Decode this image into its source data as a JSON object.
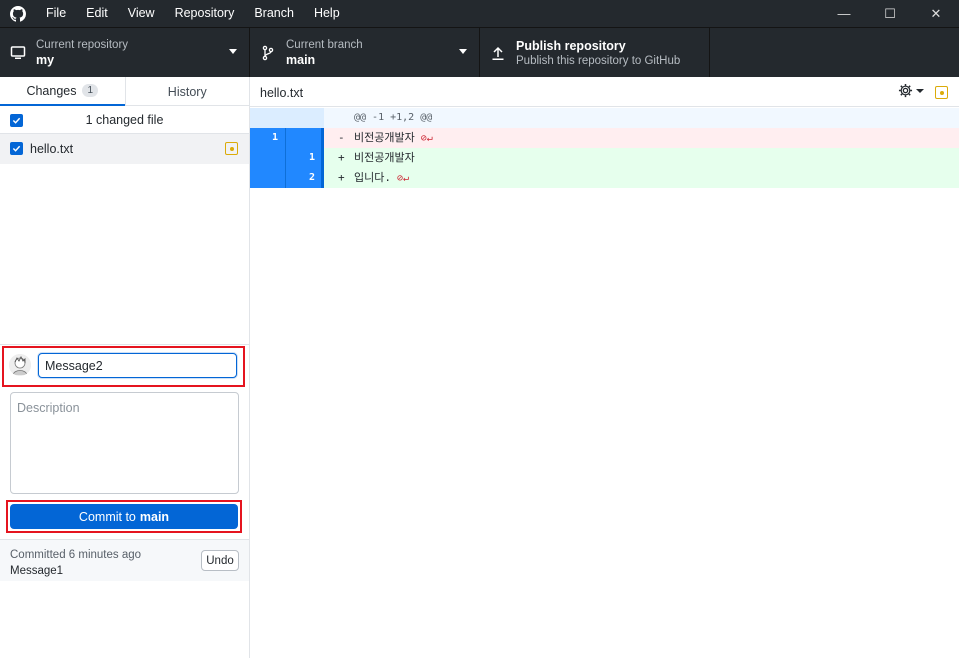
{
  "menu": [
    "File",
    "Edit",
    "View",
    "Repository",
    "Branch",
    "Help"
  ],
  "window_controls": {
    "minimize": "—",
    "maximize": "☐",
    "close": "✕"
  },
  "toolbar": {
    "repo_label": "Current repository",
    "repo_value": "my",
    "branch_label": "Current branch",
    "branch_value": "main",
    "publish_title": "Publish repository",
    "publish_sub": "Publish this repository to GitHub"
  },
  "tabs": {
    "changes": "Changes",
    "changes_count": "1",
    "history": "History"
  },
  "changes": {
    "header": "1 changed file",
    "files": [
      {
        "name": "hello.txt",
        "status": "modified"
      }
    ]
  },
  "commit": {
    "summary_value": "Message2",
    "description_placeholder": "Description",
    "button_prefix": "Commit to",
    "button_branch": "main"
  },
  "last_commit": {
    "text": "Committed 6 minutes ago",
    "message": "Message1",
    "undo": "Undo"
  },
  "diff": {
    "filename": "hello.txt",
    "hunk": "@@ -1 +1,2 @@",
    "lines": [
      {
        "type": "del",
        "old": "1",
        "new": "",
        "marker": "-",
        "text": "비전공개발자",
        "no_newline": true
      },
      {
        "type": "add",
        "old": "",
        "new": "1",
        "marker": "+",
        "text": "비전공개발자",
        "no_newline": false
      },
      {
        "type": "add",
        "old": "",
        "new": "2",
        "marker": "+",
        "text": "입니다.",
        "no_newline": true
      }
    ]
  },
  "colors": {
    "accent": "#0366d6",
    "highlight": "#e5141f",
    "modified": "#dbab09"
  }
}
